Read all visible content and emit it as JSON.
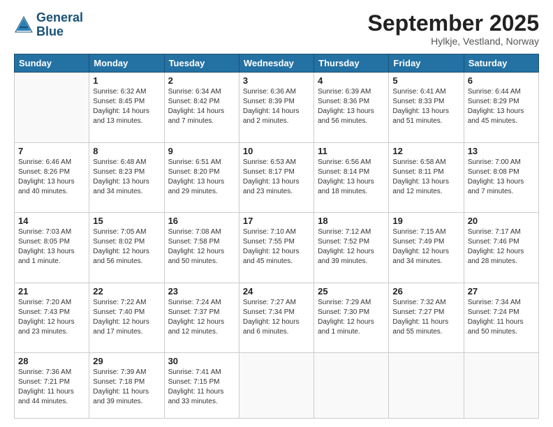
{
  "header": {
    "logo_line1": "General",
    "logo_line2": "Blue",
    "month": "September 2025",
    "location": "Hylkje, Vestland, Norway"
  },
  "weekdays": [
    "Sunday",
    "Monday",
    "Tuesday",
    "Wednesday",
    "Thursday",
    "Friday",
    "Saturday"
  ],
  "weeks": [
    [
      {
        "day": "",
        "info": ""
      },
      {
        "day": "1",
        "info": "Sunrise: 6:32 AM\nSunset: 8:45 PM\nDaylight: 14 hours\nand 13 minutes."
      },
      {
        "day": "2",
        "info": "Sunrise: 6:34 AM\nSunset: 8:42 PM\nDaylight: 14 hours\nand 7 minutes."
      },
      {
        "day": "3",
        "info": "Sunrise: 6:36 AM\nSunset: 8:39 PM\nDaylight: 14 hours\nand 2 minutes."
      },
      {
        "day": "4",
        "info": "Sunrise: 6:39 AM\nSunset: 8:36 PM\nDaylight: 13 hours\nand 56 minutes."
      },
      {
        "day": "5",
        "info": "Sunrise: 6:41 AM\nSunset: 8:33 PM\nDaylight: 13 hours\nand 51 minutes."
      },
      {
        "day": "6",
        "info": "Sunrise: 6:44 AM\nSunset: 8:29 PM\nDaylight: 13 hours\nand 45 minutes."
      }
    ],
    [
      {
        "day": "7",
        "info": "Sunrise: 6:46 AM\nSunset: 8:26 PM\nDaylight: 13 hours\nand 40 minutes."
      },
      {
        "day": "8",
        "info": "Sunrise: 6:48 AM\nSunset: 8:23 PM\nDaylight: 13 hours\nand 34 minutes."
      },
      {
        "day": "9",
        "info": "Sunrise: 6:51 AM\nSunset: 8:20 PM\nDaylight: 13 hours\nand 29 minutes."
      },
      {
        "day": "10",
        "info": "Sunrise: 6:53 AM\nSunset: 8:17 PM\nDaylight: 13 hours\nand 23 minutes."
      },
      {
        "day": "11",
        "info": "Sunrise: 6:56 AM\nSunset: 8:14 PM\nDaylight: 13 hours\nand 18 minutes."
      },
      {
        "day": "12",
        "info": "Sunrise: 6:58 AM\nSunset: 8:11 PM\nDaylight: 13 hours\nand 12 minutes."
      },
      {
        "day": "13",
        "info": "Sunrise: 7:00 AM\nSunset: 8:08 PM\nDaylight: 13 hours\nand 7 minutes."
      }
    ],
    [
      {
        "day": "14",
        "info": "Sunrise: 7:03 AM\nSunset: 8:05 PM\nDaylight: 13 hours\nand 1 minute."
      },
      {
        "day": "15",
        "info": "Sunrise: 7:05 AM\nSunset: 8:02 PM\nDaylight: 12 hours\nand 56 minutes."
      },
      {
        "day": "16",
        "info": "Sunrise: 7:08 AM\nSunset: 7:58 PM\nDaylight: 12 hours\nand 50 minutes."
      },
      {
        "day": "17",
        "info": "Sunrise: 7:10 AM\nSunset: 7:55 PM\nDaylight: 12 hours\nand 45 minutes."
      },
      {
        "day": "18",
        "info": "Sunrise: 7:12 AM\nSunset: 7:52 PM\nDaylight: 12 hours\nand 39 minutes."
      },
      {
        "day": "19",
        "info": "Sunrise: 7:15 AM\nSunset: 7:49 PM\nDaylight: 12 hours\nand 34 minutes."
      },
      {
        "day": "20",
        "info": "Sunrise: 7:17 AM\nSunset: 7:46 PM\nDaylight: 12 hours\nand 28 minutes."
      }
    ],
    [
      {
        "day": "21",
        "info": "Sunrise: 7:20 AM\nSunset: 7:43 PM\nDaylight: 12 hours\nand 23 minutes."
      },
      {
        "day": "22",
        "info": "Sunrise: 7:22 AM\nSunset: 7:40 PM\nDaylight: 12 hours\nand 17 minutes."
      },
      {
        "day": "23",
        "info": "Sunrise: 7:24 AM\nSunset: 7:37 PM\nDaylight: 12 hours\nand 12 minutes."
      },
      {
        "day": "24",
        "info": "Sunrise: 7:27 AM\nSunset: 7:34 PM\nDaylight: 12 hours\nand 6 minutes."
      },
      {
        "day": "25",
        "info": "Sunrise: 7:29 AM\nSunset: 7:30 PM\nDaylight: 12 hours\nand 1 minute."
      },
      {
        "day": "26",
        "info": "Sunrise: 7:32 AM\nSunset: 7:27 PM\nDaylight: 11 hours\nand 55 minutes."
      },
      {
        "day": "27",
        "info": "Sunrise: 7:34 AM\nSunset: 7:24 PM\nDaylight: 11 hours\nand 50 minutes."
      }
    ],
    [
      {
        "day": "28",
        "info": "Sunrise: 7:36 AM\nSunset: 7:21 PM\nDaylight: 11 hours\nand 44 minutes."
      },
      {
        "day": "29",
        "info": "Sunrise: 7:39 AM\nSunset: 7:18 PM\nDaylight: 11 hours\nand 39 minutes."
      },
      {
        "day": "30",
        "info": "Sunrise: 7:41 AM\nSunset: 7:15 PM\nDaylight: 11 hours\nand 33 minutes."
      },
      {
        "day": "",
        "info": ""
      },
      {
        "day": "",
        "info": ""
      },
      {
        "day": "",
        "info": ""
      },
      {
        "day": "",
        "info": ""
      }
    ]
  ]
}
